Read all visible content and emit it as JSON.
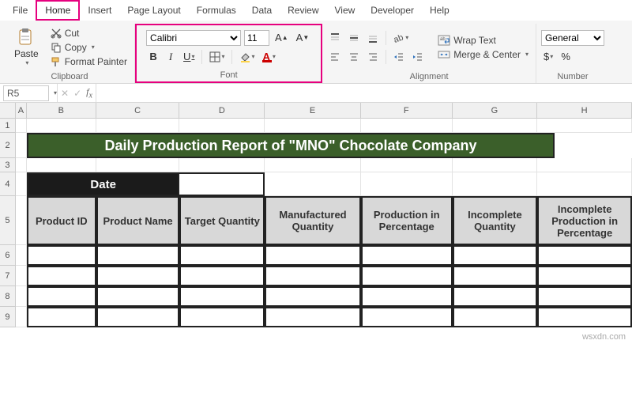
{
  "menubar": {
    "items": [
      "File",
      "Home",
      "Insert",
      "Page Layout",
      "Formulas",
      "Data",
      "Review",
      "View",
      "Developer",
      "Help"
    ],
    "active": "Home"
  },
  "ribbon": {
    "clipboard": {
      "paste": "Paste",
      "cut": "Cut",
      "copy": "Copy",
      "format_painter": "Format Painter",
      "label": "Clipboard"
    },
    "font": {
      "name": "Calibri",
      "size": "11",
      "label": "Font"
    },
    "alignment": {
      "wrap_text": "Wrap Text",
      "merge_center": "Merge & Center",
      "label": "Alignment"
    },
    "number": {
      "format": "General",
      "label": "Number"
    }
  },
  "formula_bar": {
    "cell_ref": "R5",
    "value": ""
  },
  "sheet": {
    "columns": [
      "A",
      "B",
      "C",
      "D",
      "E",
      "F",
      "G",
      "H"
    ],
    "rows": [
      "1",
      "2",
      "3",
      "4",
      "5",
      "6",
      "7",
      "8",
      "9"
    ],
    "title": "Daily Production Report of \"MNO\" Chocolate Company",
    "date_label": "Date",
    "headers": [
      "Product ID",
      "Product Name",
      "Target Quantity",
      "Manufactured Quantity",
      "Production in Percentage",
      "Incomplete Quantity",
      "Incomplete Production in Percentage"
    ]
  },
  "watermark": "wsxdn.com"
}
